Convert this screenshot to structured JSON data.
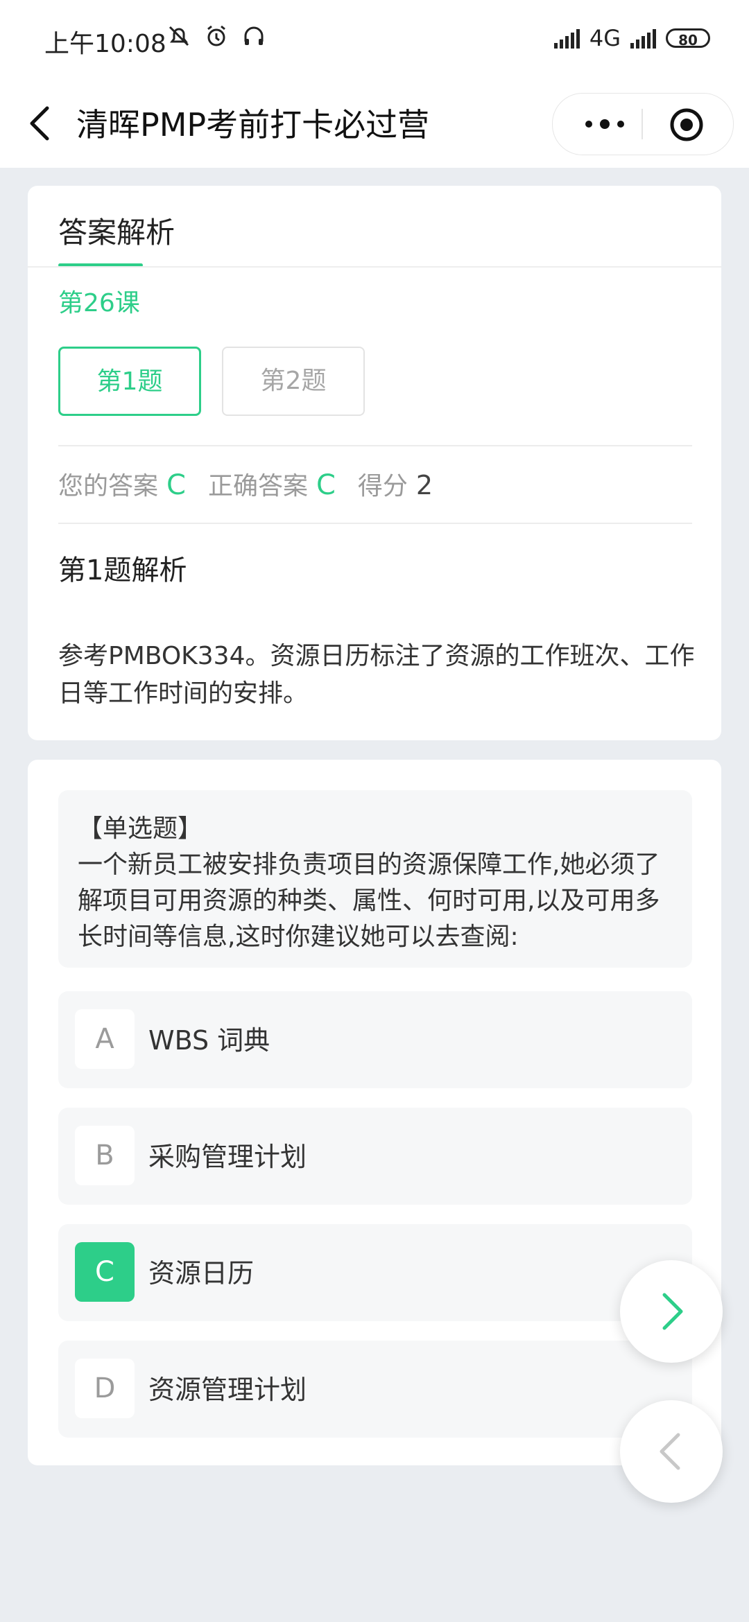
{
  "status_bar": {
    "time": "上午10:08",
    "network": "4G",
    "battery": "80"
  },
  "nav": {
    "title": "清晖PMP考前打卡必过营"
  },
  "colors": {
    "accent": "#2dce89",
    "background": "#eaedf1"
  },
  "analysis_card": {
    "tab_label": "答案解析",
    "lesson": "第26课",
    "question_tabs": [
      "第1题",
      "第2题"
    ],
    "your_answer_label": "您的答案",
    "your_answer": "C",
    "correct_answer_label": "正确答案",
    "correct_answer": "C",
    "score_label": "得分",
    "score": "2",
    "analysis_title": "第1题解析",
    "analysis_text": "参考PMBOK334。资源日历标注了资源的工作班次、工作日等工作时间的安排。"
  },
  "question_card": {
    "type_label": "【单选题】",
    "question": "一个新员工被安排负责项目的资源保障工作,她必须了解项目可用资源的种类、属性、何时可用,以及可用多长时间等信息,这时你建议她可以去查阅:",
    "options": [
      {
        "letter": "A",
        "text": "WBS 词典"
      },
      {
        "letter": "B",
        "text": "采购管理计划"
      },
      {
        "letter": "C",
        "text": "资源日历"
      },
      {
        "letter": "D",
        "text": "资源管理计划"
      }
    ],
    "selected": "C"
  }
}
